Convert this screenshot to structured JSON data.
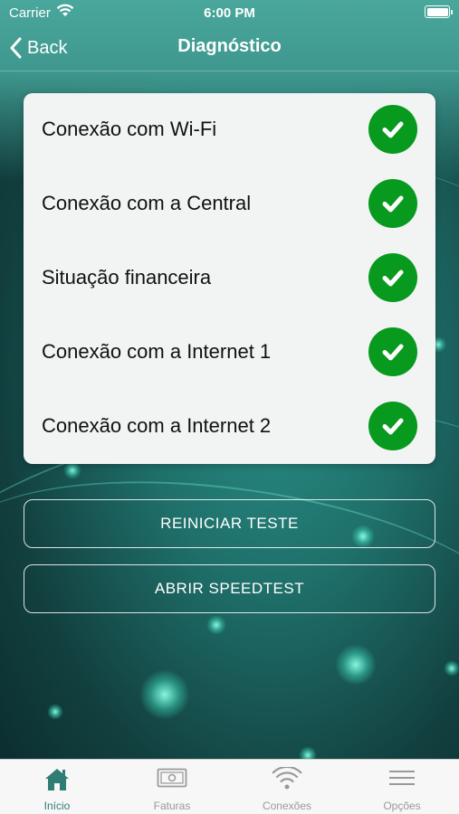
{
  "status_bar": {
    "carrier": "Carrier",
    "time": "6:00 PM"
  },
  "nav": {
    "back_label": "Back",
    "title": "Diagnóstico"
  },
  "checks": [
    {
      "label": "Conexão com Wi-Fi",
      "status": "ok"
    },
    {
      "label": "Conexão com a Central",
      "status": "ok"
    },
    {
      "label": "Situação financeira",
      "status": "ok"
    },
    {
      "label": "Conexão com a Internet 1",
      "status": "ok"
    },
    {
      "label": "Conexão com a Internet 2",
      "status": "ok"
    }
  ],
  "buttons": {
    "restart": "REINICIAR TESTE",
    "speedtest": "ABRIR SPEEDTEST"
  },
  "tabs": [
    {
      "label": "Início",
      "icon": "home-icon",
      "active": true
    },
    {
      "label": "Faturas",
      "icon": "bill-icon",
      "active": false
    },
    {
      "label": "Conexões",
      "icon": "wifi-icon",
      "active": false
    },
    {
      "label": "Opções",
      "icon": "menu-icon",
      "active": false
    }
  ],
  "colors": {
    "accent": "#2f7d74",
    "success": "#079a1e"
  }
}
